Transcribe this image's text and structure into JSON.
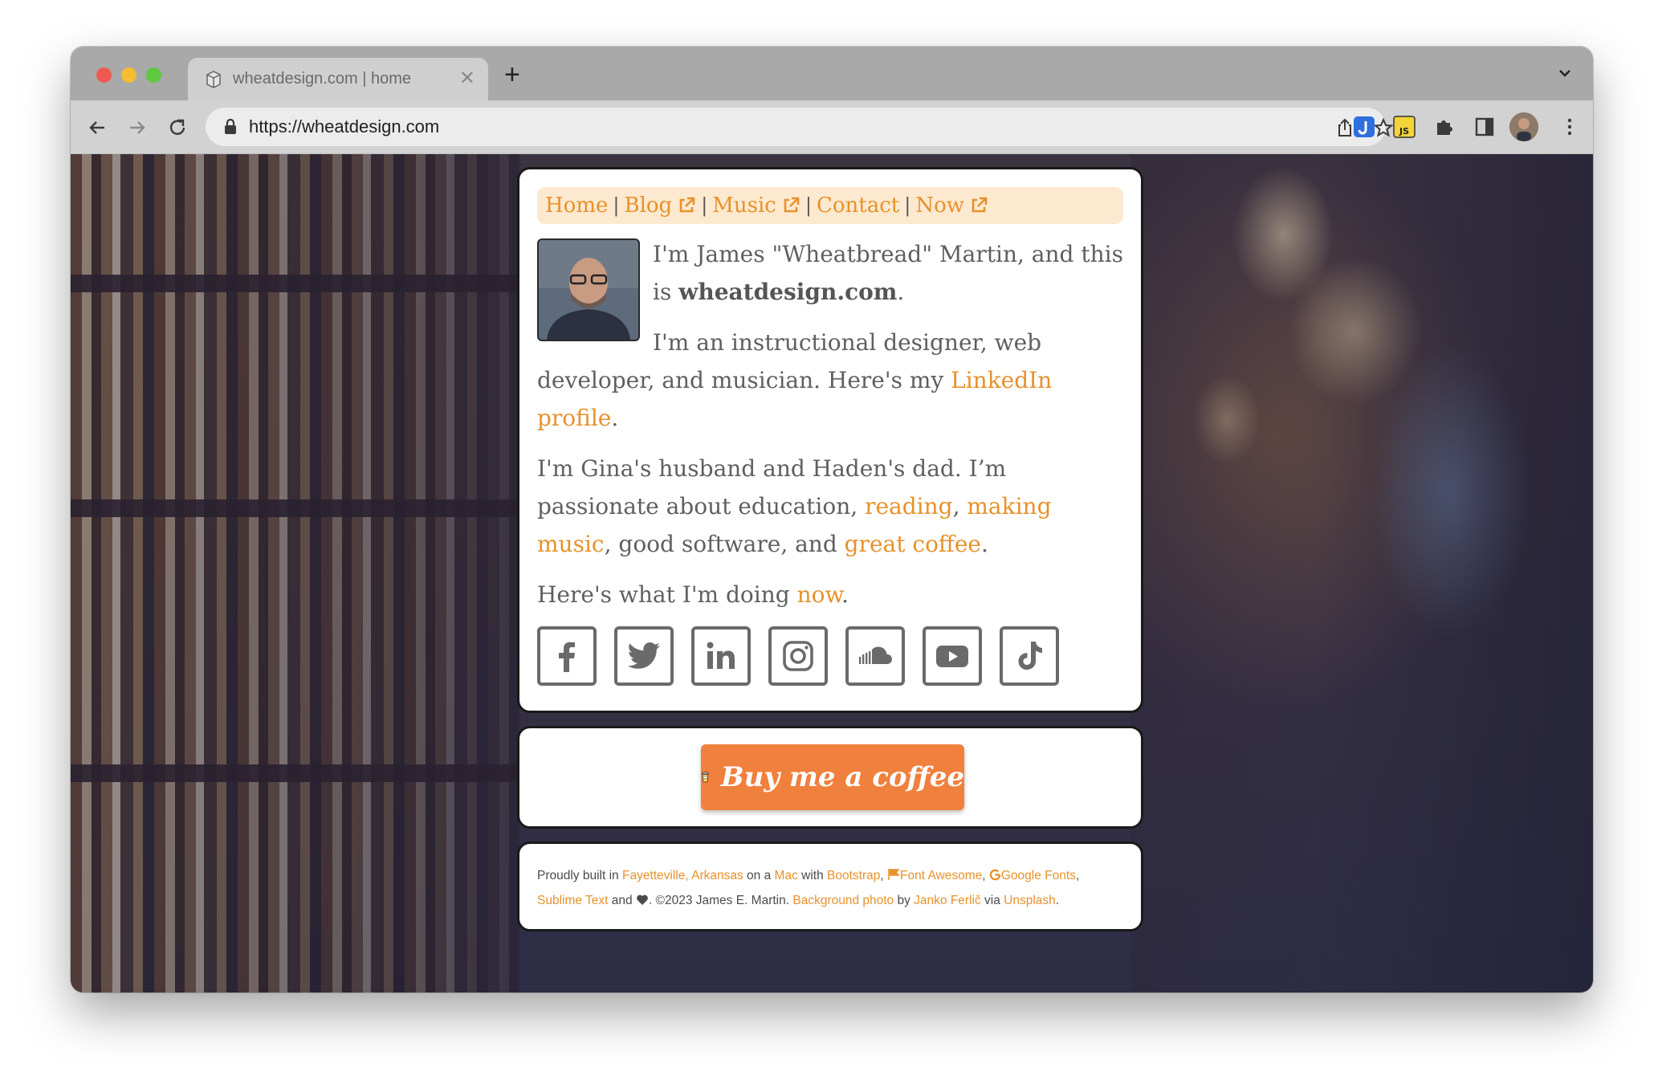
{
  "browser": {
    "tab_title": "wheatdesign.com | home",
    "tab_close": "✕",
    "new_tab": "+",
    "url": "https://wheatdesign.com"
  },
  "nav": {
    "items": [
      {
        "label": "Home",
        "external": false
      },
      {
        "label": "Blog",
        "external": true
      },
      {
        "label": "Music",
        "external": true
      },
      {
        "label": "Contact",
        "external": false
      },
      {
        "label": "Now",
        "external": true
      }
    ],
    "separator": "|"
  },
  "intro": {
    "p1_before": "I'm James \"Wheatbread\" Martin, and this is ",
    "p1_bold": "wheatdesign.com",
    "p1_after": ".",
    "p2_before": "I'm an instructional designer, web developer, and musician. Here's my ",
    "p2_link": "LinkedIn profile",
    "p2_after": ".",
    "p3_before": "I'm Gina's husband and Haden's dad. I’m passionate about education, ",
    "p3_link1": "reading",
    "p3_sep1": ", ",
    "p3_link2": "making music",
    "p3_sep2": ", good software, and ",
    "p3_link3": "great coffee",
    "p3_after": ".",
    "p4_before": "Here's what I'm doing ",
    "p4_link": "now",
    "p4_after": "."
  },
  "socials": [
    "facebook-icon",
    "twitter-icon",
    "linkedin-icon",
    "instagram-icon",
    "soundcloud-icon",
    "youtube-icon",
    "tiktok-icon"
  ],
  "coffee": {
    "label": "Buy me a coffee"
  },
  "footer": {
    "t1": "Proudly built in ",
    "l_fayetteville": "Fayetteville, Arkansas",
    "t2": " on a ",
    "l_mac": "Mac",
    "t3": " with ",
    "l_bootstrap": "Bootstrap",
    "t4": ", ",
    "l_fontawesome": "Font Awesome",
    "t5": ", ",
    "l_googlefonts": "Google Fonts",
    "t6": ",",
    "l_sublime": "Sublime Text",
    "t7": " and ",
    "t8": ". ©2023 James E. Martin. ",
    "l_bgphoto": "Background photo",
    "t9": " by ",
    "l_janko": "Janko Ferlič",
    "t10": " via ",
    "l_unsplash": "Unsplash",
    "t11": "."
  },
  "colors": {
    "accent": "#e8912b",
    "nav_bg": "#fde9cf",
    "coffee": "#f0803d",
    "text": "#5f5f5f"
  }
}
